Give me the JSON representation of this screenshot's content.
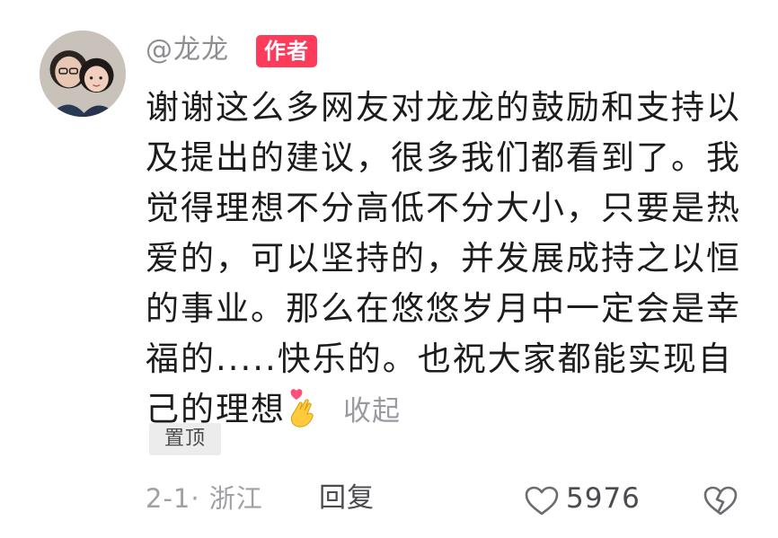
{
  "comment": {
    "username": "@龙龙",
    "author_badge": "作者",
    "body_text": "谢谢这么多网友对龙龙的鼓励和支持以及提出的建议，很多我们都看到了。我觉得理想不分高低不分大小，只要是热爱的，可以坚持的，并发展成持之以恒的事业。那么在悠悠岁月中一定会是幸福的.....快乐的。也祝大家都能实现自己的理想",
    "emoji": "heart-hands-emoji",
    "collapse_label": "收起",
    "pinned_label": "置顶",
    "date_location": "2-1· 浙江",
    "reply_label": "回复",
    "like_count": "5976"
  },
  "icons": {
    "like": "heart-outline-icon",
    "dislike": "broken-heart-icon"
  },
  "colors": {
    "badge": "#ff3b5c",
    "body_text": "#1c1c1e",
    "muted_text": "#9a9aa0"
  }
}
